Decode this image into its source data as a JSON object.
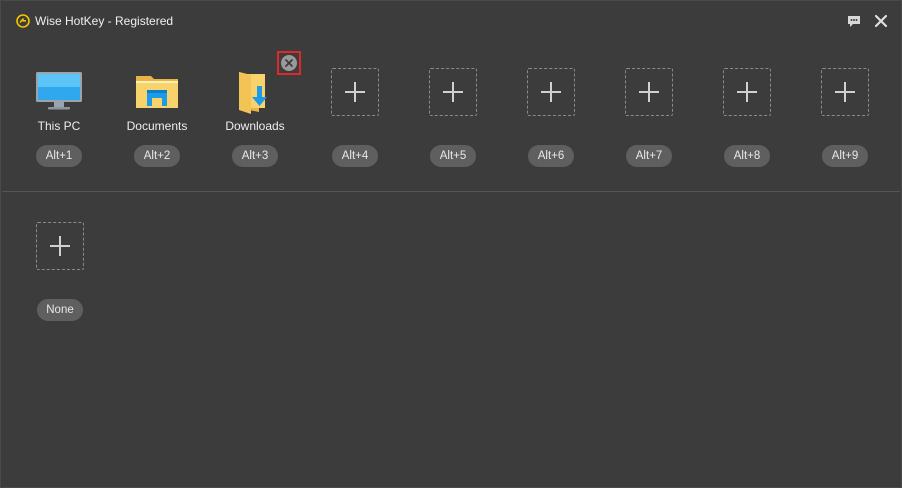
{
  "window": {
    "title": "Wise HotKey - Registered"
  },
  "slots": [
    {
      "label": "This PC",
      "hotkey": "Alt+1",
      "icon": "monitor-icon"
    },
    {
      "label": "Documents",
      "hotkey": "Alt+2",
      "icon": "folder-documents-icon"
    },
    {
      "label": "Downloads",
      "hotkey": "Alt+3",
      "icon": "folder-downloads-icon"
    },
    {
      "label": "",
      "hotkey": "Alt+4",
      "icon": "add-icon"
    },
    {
      "label": "",
      "hotkey": "Alt+5",
      "icon": "add-icon"
    },
    {
      "label": "",
      "hotkey": "Alt+6",
      "icon": "add-icon"
    },
    {
      "label": "",
      "hotkey": "Alt+7",
      "icon": "add-icon"
    },
    {
      "label": "",
      "hotkey": "Alt+8",
      "icon": "add-icon"
    },
    {
      "label": "",
      "hotkey": "Alt+9",
      "icon": "add-icon"
    }
  ],
  "extra_slot": {
    "hotkey": "None",
    "icon": "add-icon"
  },
  "colors": {
    "background": "#3c3c3c",
    "pill": "#5f5f5f",
    "highlight": "#e02828",
    "accent": "#f5c400"
  }
}
